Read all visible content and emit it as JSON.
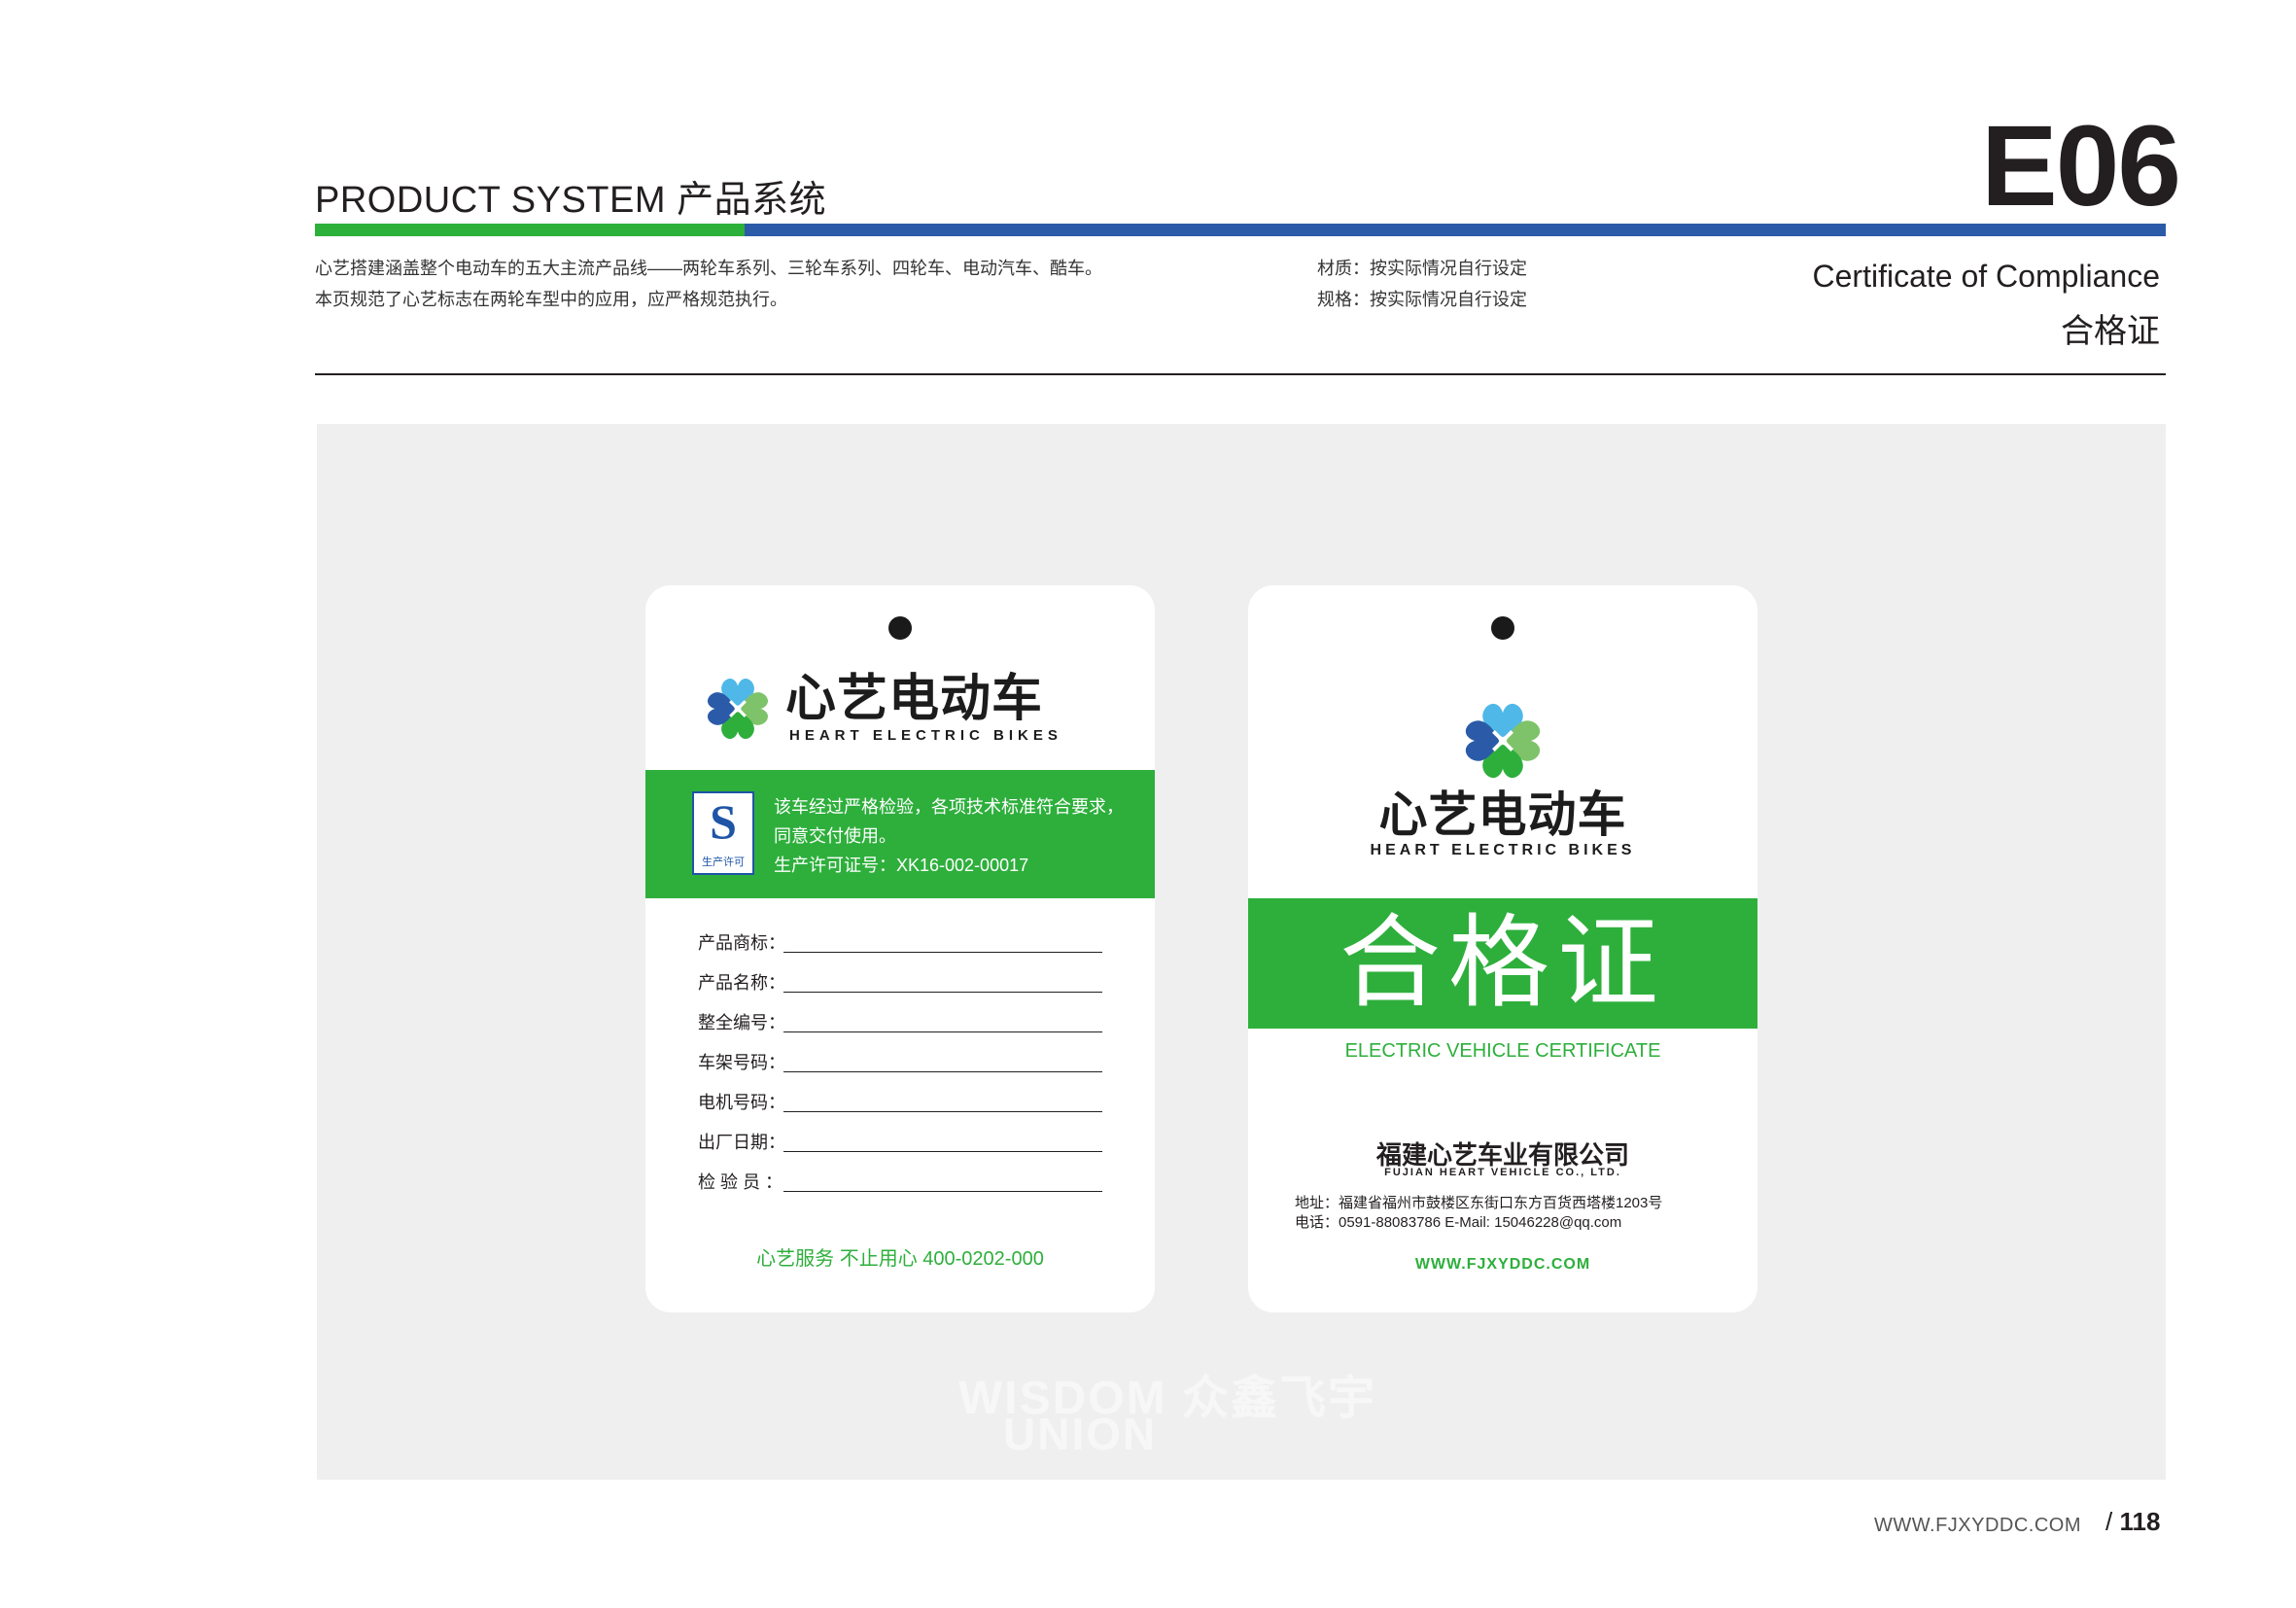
{
  "header": {
    "title": "PRODUCT SYSTEM 产品系统",
    "code": "E06",
    "description_lines": [
      "心艺搭建涵盖整个电动车的五大主流产品线——两轮车系列、三轮车系列、四轮车、电动汽车、酷车。",
      "本页规范了心艺标志在两轮车型中的应用，应严格规范执行。"
    ],
    "spec_lines": [
      "材质：按实际情况自行设定",
      "规格：按实际情况自行设定"
    ],
    "subtitle_en": "Certificate of Compliance",
    "subtitle_zh": "合格证"
  },
  "brand": {
    "name_cn": "心艺电动车",
    "name_en": "HEART ELECTRIC BIKES",
    "colors": {
      "green": "#2eaf3c",
      "blue": "#2b5ba8",
      "light_blue": "#4fb8e8",
      "light_green": "#7ec36a"
    }
  },
  "card_left": {
    "qs_letter": "S",
    "qs_caption": "生产许可",
    "notice_lines": [
      "该车经过严格检验，各项技术标准符合要求，",
      "同意交付使用。",
      "生产许可证号：XK16-002-00017"
    ],
    "fields": [
      "产品商标：",
      "产品名称：",
      "整全编号：",
      "车架号码：",
      "电机号码：",
      "出厂日期：",
      "检 验 员 ："
    ],
    "service": "心艺服务 不止用心 400-0202-000"
  },
  "card_right": {
    "title": "合格证",
    "title_en": "ELECTRIC VEHICLE CERTIFICATE",
    "company_cn": "福建心艺车业有限公司",
    "company_en": "FUJIAN HEART VEHICLE CO., LTD.",
    "address": "地址：福建省福州市鼓楼区东街口东方百货西塔楼1203号",
    "contact": "电话：0591-88083786   E-Mail: 15046228@qq.com",
    "website": "WWW.FJXYDDC.COM"
  },
  "watermark": {
    "line1": "WISDOM 众鑫飞宇",
    "line2": "UNION"
  },
  "footer": {
    "url": "WWW.FJXYDDC.COM",
    "page": "118"
  }
}
